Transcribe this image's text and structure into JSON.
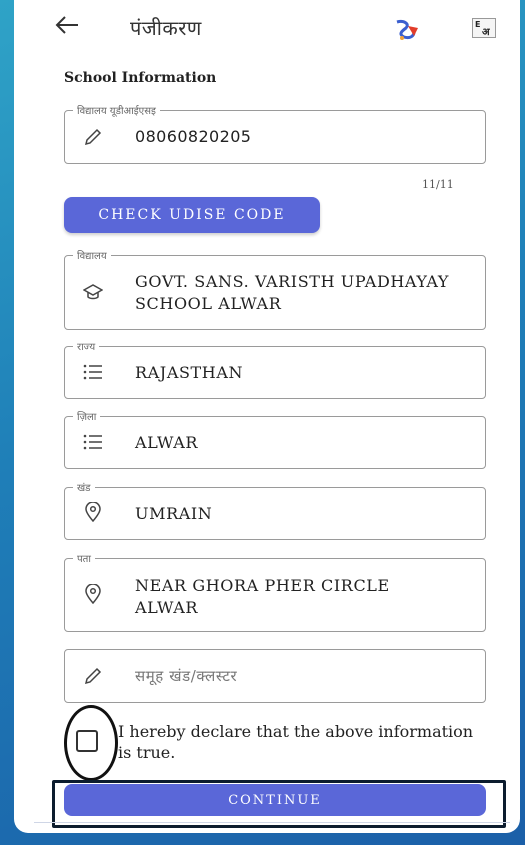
{
  "appbar": {
    "title": "पंजीकरण",
    "back_icon": "arrow-left-icon",
    "logo_icon": "app-logo-icon",
    "lang_icon": "language-toggle-icon"
  },
  "section": {
    "title": "School Information"
  },
  "udise": {
    "label": "विद्यालय यूडीआईएसइ",
    "value": "08060820205",
    "counter": "11/11",
    "icon": "pencil-icon"
  },
  "check_button": {
    "label": "CHECK UDISE CODE"
  },
  "school": {
    "label": "विद्यालय",
    "value": "GOVT.  SANS. VARISTH UPADHAYAY SCHOOL ALWAR",
    "icon": "school-cap-icon"
  },
  "state": {
    "label": "राज्य",
    "value": "RAJASTHAN",
    "icon": "list-icon"
  },
  "district": {
    "label": "ज़िला",
    "value": "ALWAR",
    "icon": "list-icon"
  },
  "block": {
    "label": "खंड",
    "value": "UMRAIN",
    "icon": "location-pin-icon"
  },
  "address": {
    "label": "पता",
    "value": "NEAR GHORA PHER CIRCLE ALWAR",
    "icon": "location-pin-icon"
  },
  "cluster": {
    "placeholder": "समूह खंड/क्लस्टर",
    "icon": "pencil-icon"
  },
  "declaration": {
    "text": "I hereby declare that the above information is true."
  },
  "continue_button": {
    "label": "CONTINUE"
  },
  "colors": {
    "accent": "#5a67d8",
    "background_gradient_start": "#2fa3c7",
    "background_gradient_end": "#1b5fa8"
  }
}
